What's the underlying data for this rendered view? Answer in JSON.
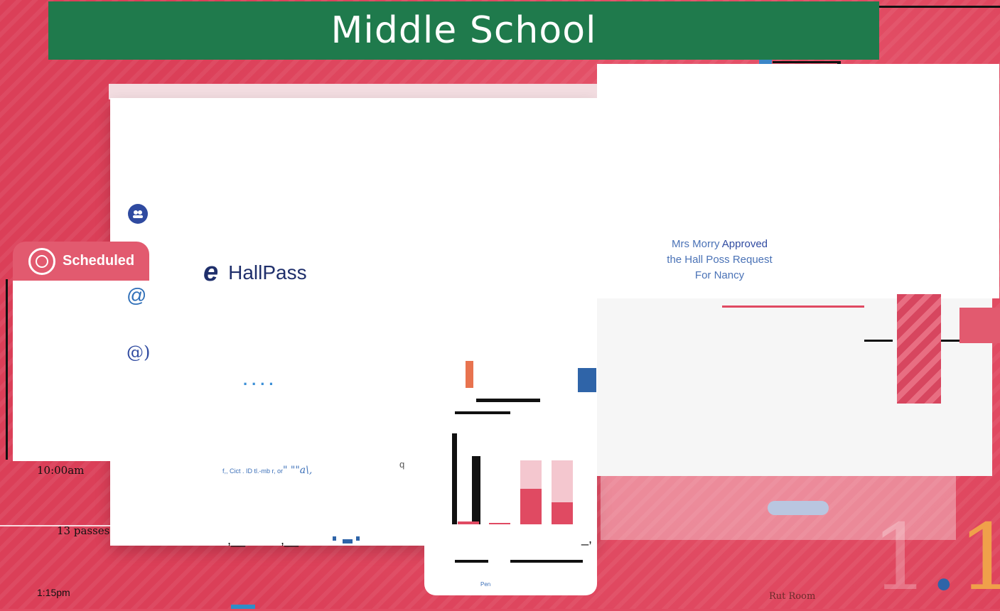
{
  "banner": {
    "title": "Middle School"
  },
  "app": {
    "brand_letter": "e",
    "brand_name": "HallPass"
  },
  "sidebar": {
    "scheduled_label": "Scheduled",
    "icon_1": "user-group-icon",
    "icon_2": "at-icon",
    "icon_3": "at-icon"
  },
  "notification": {
    "line1_prefix": "Mrs Morry ",
    "line1_status": "Approved",
    "line2": "the Hall Poss Request",
    "line3": "For Nancy"
  },
  "schedule": {
    "time_1": "10:00am",
    "passes": "13 passes",
    "time_2": "1:15pm"
  },
  "misc": {
    "dots": "....",
    "garbled_text": "f,, Cict . ID tl.-mb r, or",
    "garbled_text_2": "\" \"\"a\\,",
    "q_label": "q",
    "pen_label": "Pen",
    "room_label": "Rut Room",
    "big_number_left": "1",
    "big_number_dot": ".",
    "big_number_right": "1"
  },
  "chart_data": {
    "type": "bar",
    "categories": [
      "",
      "",
      "",
      ""
    ],
    "values": [
      4,
      2,
      55,
      35
    ],
    "ylim": [
      0,
      100
    ],
    "title": "",
    "xlabel": "",
    "ylabel": ""
  },
  "colors": {
    "banner": "#1f7a4c",
    "background": "#e04a62",
    "accent_blue": "#4a72b6",
    "brand_navy": "#1f2f6b",
    "orange": "#f0a04a"
  }
}
